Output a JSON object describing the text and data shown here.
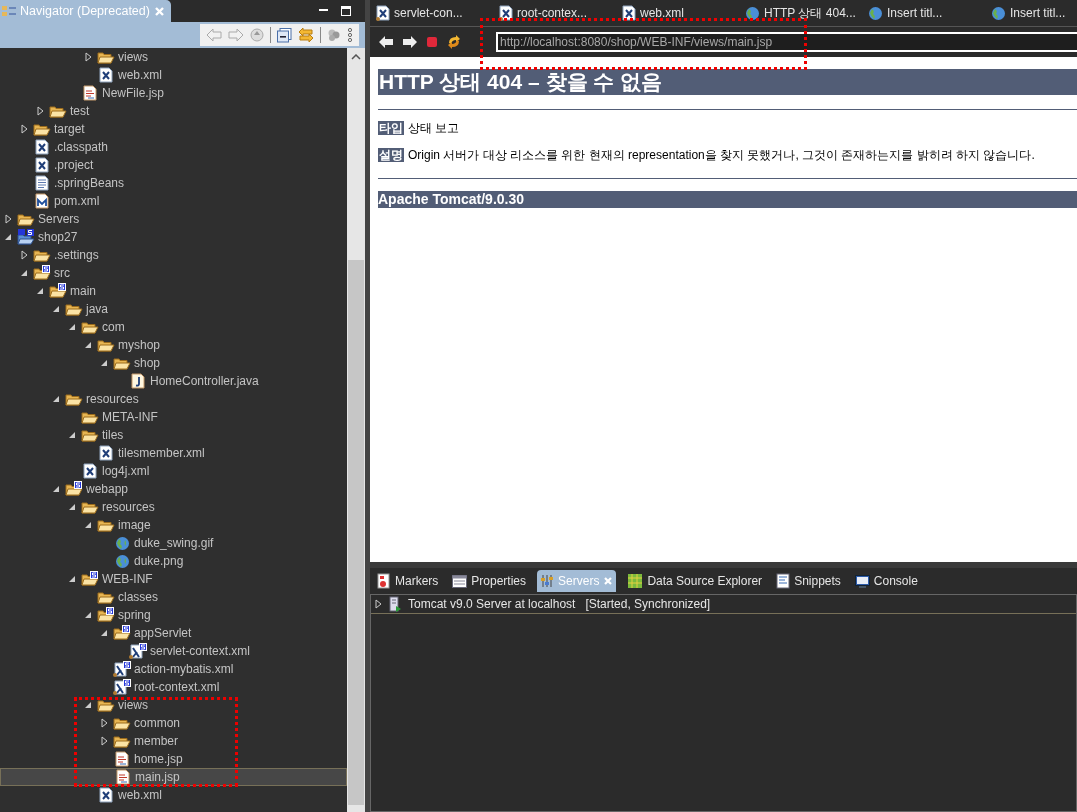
{
  "navigator": {
    "title": "Navigator (Deprecated)",
    "tree": [
      {
        "children": [
          {
            "children": [
              {
                "children": [
                  {
                    "children": [
                      {
                        "children": [
                          {
                            "label": "views",
                            "kind": "folder",
                            "expanded": false,
                            "selected": false
                          },
                          {
                            "label": "web.xml",
                            "kind": "xml",
                            "selected": false
                          }
                        ]
                      },
                      {
                        "label": "NewFile.jsp",
                        "kind": "jsp",
                        "selected": false
                      }
                    ]
                  }
                ]
              },
              {
                "label": "test",
                "kind": "folder",
                "expanded": false,
                "selected": false
              }
            ]
          },
          {
            "label": "target",
            "kind": "folder",
            "expanded": false,
            "selected": false
          },
          {
            "label": ".classpath",
            "kind": "xml",
            "selected": false
          },
          {
            "label": ".project",
            "kind": "xml",
            "selected": false
          },
          {
            "label": ".springBeans",
            "kind": "text",
            "selected": false
          },
          {
            "label": "pom.xml",
            "kind": "maven",
            "selected": false
          }
        ]
      },
      {
        "label": "Servers",
        "kind": "folder",
        "expanded": false,
        "selected": false
      },
      {
        "label": "shop27",
        "kind": "project",
        "expanded": true,
        "selected": false,
        "children": [
          {
            "label": ".settings",
            "kind": "folder",
            "expanded": false,
            "selected": false
          },
          {
            "label": "src",
            "kind": "springfolder",
            "expanded": true,
            "selected": false,
            "children": [
              {
                "label": "main",
                "kind": "springfolder",
                "expanded": true,
                "selected": false,
                "children": [
                  {
                    "label": "java",
                    "kind": "folder",
                    "expanded": true,
                    "selected": false,
                    "children": [
                      {
                        "label": "com",
                        "kind": "folder",
                        "expanded": true,
                        "selected": false,
                        "children": [
                          {
                            "label": "myshop",
                            "kind": "folder",
                            "expanded": true,
                            "selected": false,
                            "children": [
                              {
                                "label": "shop",
                                "kind": "folder",
                                "expanded": true,
                                "selected": false,
                                "children": [
                                  {
                                    "label": "HomeController.java",
                                    "kind": "java",
                                    "selected": false
                                  }
                                ]
                              }
                            ]
                          }
                        ]
                      }
                    ]
                  },
                  {
                    "label": "resources",
                    "kind": "folder",
                    "expanded": true,
                    "selected": false,
                    "children": [
                      {
                        "label": "META-INF",
                        "kind": "folder",
                        "selected": false
                      },
                      {
                        "label": "tiles",
                        "kind": "folder",
                        "expanded": true,
                        "selected": false,
                        "children": [
                          {
                            "label": "tilesmember.xml",
                            "kind": "xml",
                            "selected": false
                          }
                        ]
                      },
                      {
                        "label": "log4j.xml",
                        "kind": "xml",
                        "selected": false
                      }
                    ]
                  },
                  {
                    "label": "webapp",
                    "kind": "springfolder",
                    "expanded": true,
                    "selected": false,
                    "children": [
                      {
                        "label": "resources",
                        "kind": "folder",
                        "expanded": true,
                        "selected": false,
                        "children": [
                          {
                            "label": "image",
                            "kind": "folder",
                            "expanded": true,
                            "selected": false,
                            "children": [
                              {
                                "label": "duke_swing.gif",
                                "kind": "web",
                                "selected": false
                              },
                              {
                                "label": "duke.png",
                                "kind": "web",
                                "selected": false
                              }
                            ]
                          }
                        ]
                      },
                      {
                        "label": "WEB-INF",
                        "kind": "springfolder",
                        "expanded": true,
                        "selected": false,
                        "children": [
                          {
                            "label": "classes",
                            "kind": "folder",
                            "selected": false
                          },
                          {
                            "label": "spring",
                            "kind": "springfolder",
                            "expanded": true,
                            "selected": false,
                            "children": [
                              {
                                "label": "appServlet",
                                "kind": "springfolder",
                                "expanded": true,
                                "selected": false,
                                "children": [
                                  {
                                    "label": "servlet-context.xml",
                                    "kind": "springxml",
                                    "selected": false
                                  }
                                ]
                              },
                              {
                                "label": "action-mybatis.xml",
                                "kind": "springxml",
                                "selected": false
                              },
                              {
                                "label": "root-context.xml",
                                "kind": "springxml",
                                "selected": false
                              }
                            ]
                          },
                          {
                            "label": "views",
                            "kind": "folder",
                            "expanded": true,
                            "selected": false,
                            "children": [
                              {
                                "label": "common",
                                "kind": "folder",
                                "expanded": false,
                                "selected": false
                              },
                              {
                                "label": "member",
                                "kind": "folder",
                                "expanded": false,
                                "selected": false
                              },
                              {
                                "label": "home.jsp",
                                "kind": "jsp",
                                "selected": false
                              },
                              {
                                "label": "main.jsp",
                                "kind": "jsp",
                                "selected": true
                              }
                            ]
                          },
                          {
                            "label": "web.xml",
                            "kind": "xml",
                            "selected": false
                          }
                        ]
                      }
                    ]
                  }
                ]
              }
            ]
          }
        ]
      }
    ]
  },
  "editor_tabs": [
    {
      "label": "servlet-con...",
      "kind": "springxml"
    },
    {
      "label": "root-contex...",
      "kind": "springxml"
    },
    {
      "label": "web.xml",
      "kind": "xml"
    },
    {
      "label": "HTTP 상태 404...",
      "kind": "web"
    },
    {
      "label": "Insert titl...",
      "kind": "web"
    },
    {
      "label": "Insert titl...",
      "kind": "web"
    }
  ],
  "browser": {
    "url": "http://localhost:8080/shop/WEB-INF/views/main.jsp",
    "heading": "HTTP 상태 404 – 찾을 수 없음",
    "fields": [
      {
        "label": "타입",
        "text": "상태 보고"
      },
      {
        "label": "설명",
        "text": "Origin 서버가 대상 리소스를 위한 현재의 representation을 찾지 못했거나, 그것이 존재하는지를 밝히려 하지 않습니다."
      }
    ],
    "footer": "Apache Tomcat/9.0.30"
  },
  "view_tabs": [
    {
      "label": "Markers",
      "kind": "markers",
      "selected": false
    },
    {
      "label": "Properties",
      "kind": "properties",
      "selected": false
    },
    {
      "label": "Servers",
      "kind": "servers",
      "selected": true
    },
    {
      "label": "Data Source Explorer",
      "kind": "datasource",
      "selected": false
    },
    {
      "label": "Snippets",
      "kind": "snippets",
      "selected": false
    },
    {
      "label": "Console",
      "kind": "console",
      "selected": false
    }
  ],
  "servers": [
    {
      "name": "Tomcat v9.0 Server at localhost",
      "status": "[Started, Synchronized]",
      "expanded": false
    }
  ]
}
